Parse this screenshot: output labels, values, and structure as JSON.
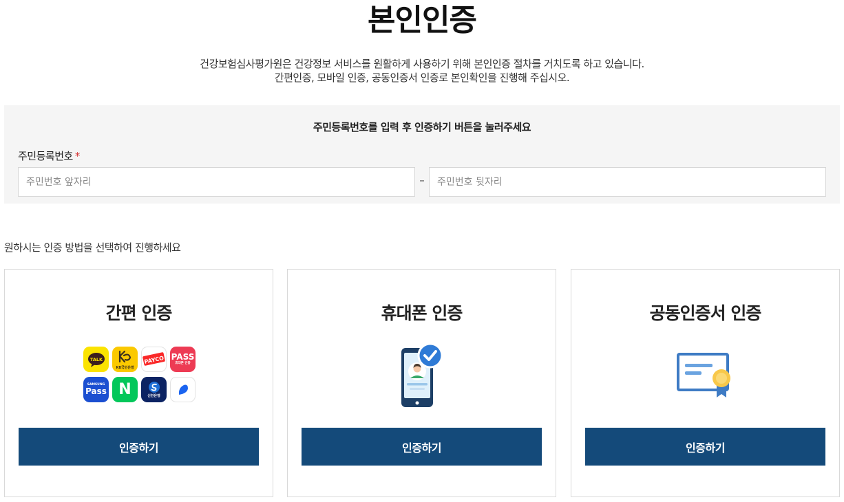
{
  "page": {
    "title": "본인인증",
    "intro_line1": "건강보험심사평가원은 건강정보 서비스를 원활하게 사용하기 위해 본인인증 절차를 거치도록 하고 있습니다.",
    "intro_line2": "간편인증, 모바일 인증, 공동인증서 인증로 본인확인을 진행해 주십시오."
  },
  "id_form": {
    "instruction": "주민등록번호를 입력 후 인증하기 버튼을 눌러주세요",
    "label": "주민등록번호",
    "required_mark": "*",
    "front_placeholder": "주민번호 앞자리",
    "separator": "–",
    "back_placeholder": "주민번호 뒷자리"
  },
  "method_guide": "원하시는 인증 방법을 선택하여 진행하세요",
  "cards": [
    {
      "title": "간편 인증",
      "button_label": "인증하기",
      "icon": "simple-auth-apps-icon"
    },
    {
      "title": "휴대폰 인증",
      "button_label": "인증하기",
      "icon": "mobile-phone-verified-icon"
    },
    {
      "title": "공동인증서 인증",
      "button_label": "인증하기",
      "icon": "certificate-icon"
    }
  ],
  "apps": {
    "kakao": "TALK",
    "kb": "KB국민은행",
    "payco": "PAYCO",
    "pass": "PASS",
    "pass_sub": "휴대폰 인증",
    "samsung_top": "SAMSUNG",
    "samsung": "Pass",
    "naver": "N",
    "shinhan": "신한은행"
  },
  "colors": {
    "button_bg": "#144a7a",
    "panel_bg": "#f5f5f5",
    "required": "#d32f2f",
    "accent_blue": "#2f7bd6"
  }
}
